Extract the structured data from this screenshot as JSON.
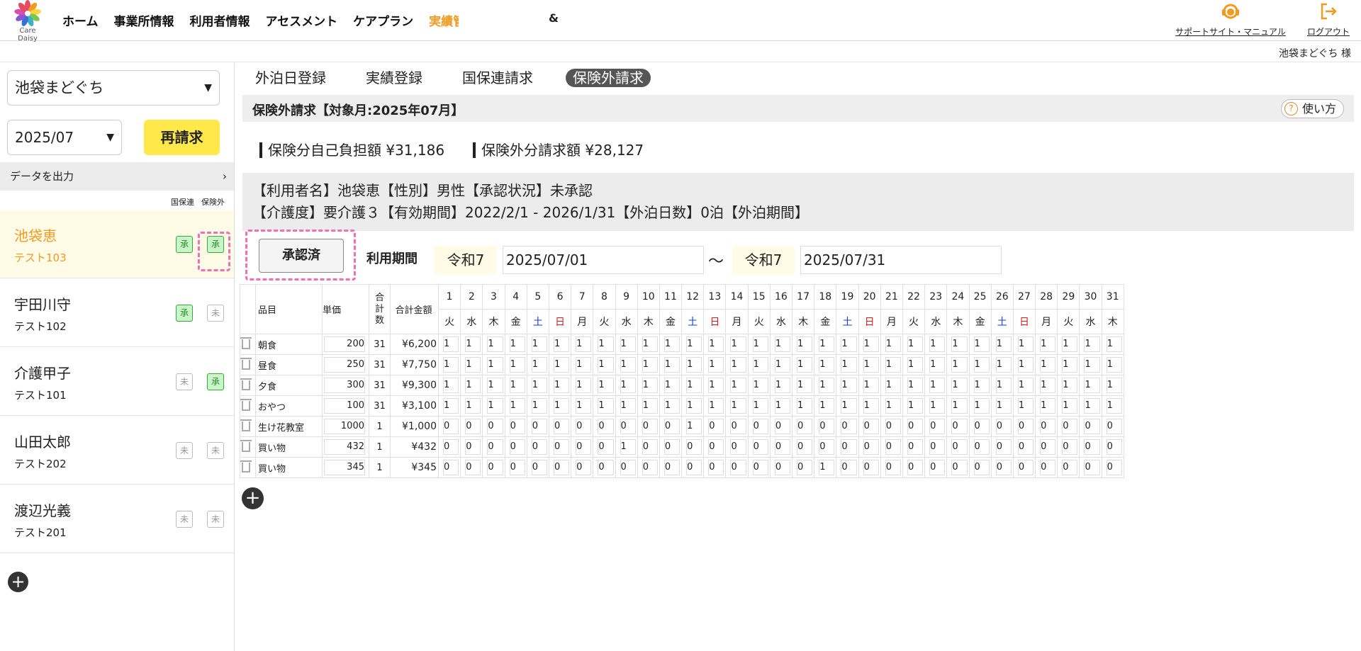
{
  "brand": {
    "logo_text": "Care Daisy"
  },
  "nav": {
    "items": [
      "ホーム",
      "事業所情報",
      "利用者情報",
      "アセスメント",
      "ケアプラン"
    ],
    "active_clipped": "実績管理",
    "fragment": "&"
  },
  "header": {
    "support_label": "サポートサイト・マニュアル",
    "logout_label": "ログアウト",
    "user_name": "池袋まどぐち 様"
  },
  "sidebar": {
    "facility": "池袋まどぐち",
    "month": "2025/07",
    "rebill_label": "再請求",
    "export_label": "データを出力",
    "col_head_1": "国保連",
    "col_head_2": "保険外",
    "residents": [
      {
        "name": "池袋恵",
        "sub": "テスト103",
        "b1": "承",
        "b1_on": true,
        "b2": "承",
        "b2_on": true
      },
      {
        "name": "宇田川守",
        "sub": "テスト102",
        "b1": "承",
        "b1_on": true,
        "b2": "未",
        "b2_on": false
      },
      {
        "name": "介護甲子",
        "sub": "テスト101",
        "b1": "未",
        "b1_on": false,
        "b2": "承",
        "b2_on": true
      },
      {
        "name": "山田太郎",
        "sub": "テスト202",
        "b1": "未",
        "b1_on": false,
        "b2": "未",
        "b2_on": false
      },
      {
        "name": "渡辺光義",
        "sub": "テスト201",
        "b1": "未",
        "b1_on": false,
        "b2": "未",
        "b2_on": false
      }
    ]
  },
  "tabs": [
    "外泊日登録",
    "実績登録",
    "国保連請求",
    "保険外請求"
  ],
  "main": {
    "title": "保険外請求【対象月:2025年07月】",
    "howto_label": "使い方",
    "total_insured": "保険分自己負担額 ¥31,186",
    "total_uninsured": "保険外分請求額 ¥28,127",
    "info_line1": "【利用者名】池袋恵【性別】男性【承認状況】未承認",
    "info_line2": "【介護度】要介護３【有効期間】2022/2/1 - 2026/1/31【外泊日数】0泊【外泊期間】",
    "approved_label": "承認済",
    "period_label": "利用期間",
    "era_from": "令和7",
    "date_from": "2025/07/01",
    "tilde": "〜",
    "era_to": "令和7",
    "date_to": "2025/07/31"
  },
  "table": {
    "h_item": "品目",
    "h_price": "単価",
    "h_count": "合計数",
    "h_amount": "合計金額",
    "days": [
      "1",
      "2",
      "3",
      "4",
      "5",
      "6",
      "7",
      "8",
      "9",
      "10",
      "11",
      "12",
      "13",
      "14",
      "15",
      "16",
      "17",
      "18",
      "19",
      "20",
      "21",
      "22",
      "23",
      "24",
      "25",
      "26",
      "27",
      "28",
      "29",
      "30",
      "31"
    ],
    "dows": [
      "火",
      "水",
      "木",
      "金",
      "土",
      "日",
      "月",
      "火",
      "水",
      "木",
      "金",
      "土",
      "日",
      "月",
      "火",
      "水",
      "木",
      "金",
      "土",
      "日",
      "月",
      "火",
      "水",
      "木",
      "金",
      "土",
      "日",
      "月",
      "火",
      "水",
      "木"
    ],
    "rows": [
      {
        "item": "朝食",
        "price": "200",
        "count": "31",
        "amount": "¥6,200",
        "cells": [
          "1",
          "1",
          "1",
          "1",
          "1",
          "1",
          "1",
          "1",
          "1",
          "1",
          "1",
          "1",
          "1",
          "1",
          "1",
          "1",
          "1",
          "1",
          "1",
          "1",
          "1",
          "1",
          "1",
          "1",
          "1",
          "1",
          "1",
          "1",
          "1",
          "1",
          "1"
        ]
      },
      {
        "item": "昼食",
        "price": "250",
        "count": "31",
        "amount": "¥7,750",
        "cells": [
          "1",
          "1",
          "1",
          "1",
          "1",
          "1",
          "1",
          "1",
          "1",
          "1",
          "1",
          "1",
          "1",
          "1",
          "1",
          "1",
          "1",
          "1",
          "1",
          "1",
          "1",
          "1",
          "1",
          "1",
          "1",
          "1",
          "1",
          "1",
          "1",
          "1",
          "1"
        ]
      },
      {
        "item": "夕食",
        "price": "300",
        "count": "31",
        "amount": "¥9,300",
        "cells": [
          "1",
          "1",
          "1",
          "1",
          "1",
          "1",
          "1",
          "1",
          "1",
          "1",
          "1",
          "1",
          "1",
          "1",
          "1",
          "1",
          "1",
          "1",
          "1",
          "1",
          "1",
          "1",
          "1",
          "1",
          "1",
          "1",
          "1",
          "1",
          "1",
          "1",
          "1"
        ]
      },
      {
        "item": "おやつ",
        "price": "100",
        "count": "31",
        "amount": "¥3,100",
        "cells": [
          "1",
          "1",
          "1",
          "1",
          "1",
          "1",
          "1",
          "1",
          "1",
          "1",
          "1",
          "1",
          "1",
          "1",
          "1",
          "1",
          "1",
          "1",
          "1",
          "1",
          "1",
          "1",
          "1",
          "1",
          "1",
          "1",
          "1",
          "1",
          "1",
          "1",
          "1"
        ]
      },
      {
        "item": "生け花教室",
        "price": "1000",
        "count": "1",
        "amount": "¥1,000",
        "cells": [
          "0",
          "0",
          "0",
          "0",
          "0",
          "0",
          "0",
          "0",
          "0",
          "0",
          "0",
          "1",
          "0",
          "0",
          "0",
          "0",
          "0",
          "0",
          "0",
          "0",
          "0",
          "0",
          "0",
          "0",
          "0",
          "0",
          "0",
          "0",
          "0",
          "0",
          "0"
        ]
      },
      {
        "item": "買い物",
        "price": "432",
        "count": "1",
        "amount": "¥432",
        "cells": [
          "0",
          "0",
          "0",
          "0",
          "0",
          "0",
          "0",
          "0",
          "1",
          "0",
          "0",
          "0",
          "0",
          "0",
          "0",
          "0",
          "0",
          "0",
          "0",
          "0",
          "0",
          "0",
          "0",
          "0",
          "0",
          "0",
          "0",
          "0",
          "0",
          "0",
          "0"
        ]
      },
      {
        "item": "買い物",
        "price": "345",
        "count": "1",
        "amount": "¥345",
        "cells": [
          "0",
          "0",
          "0",
          "0",
          "0",
          "0",
          "0",
          "0",
          "0",
          "0",
          "0",
          "0",
          "0",
          "0",
          "0",
          "0",
          "0",
          "1",
          "0",
          "0",
          "0",
          "0",
          "0",
          "0",
          "0",
          "0",
          "0",
          "0",
          "0",
          "0",
          "0"
        ]
      }
    ]
  },
  "colors": {
    "accent": "#f29a1f",
    "rebill": "#ffe94a",
    "approved": "#c9f5c9",
    "focus": "#f06fb8",
    "sat": "#1a3dd1",
    "sun": "#e01a1a"
  }
}
